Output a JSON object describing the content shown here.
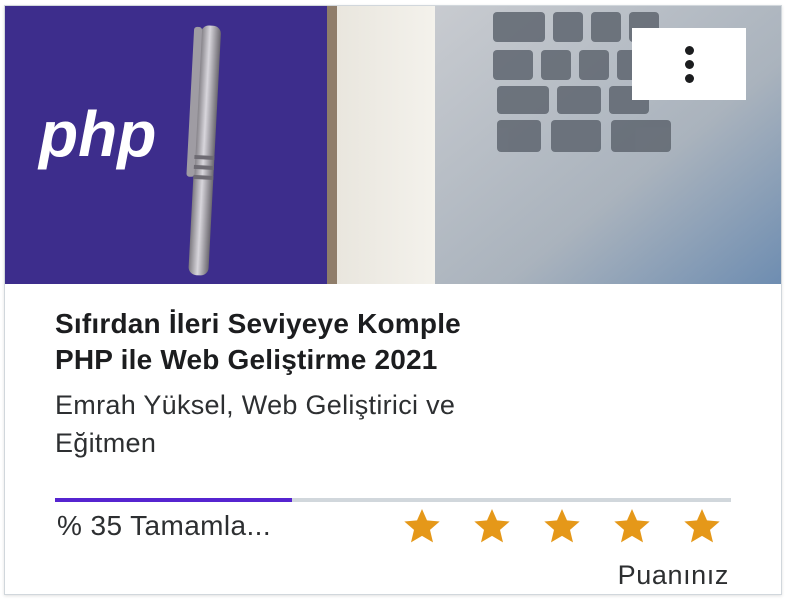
{
  "course": {
    "title_line1": "Sıfırdan İleri Seviyeye Komple",
    "title_line2": "PHP ile Web Geliştirme 2021",
    "instructor_line1": "Emrah Yüksel, Web Geliştirici ve",
    "instructor_line2": "Eğitmen",
    "thumbnail_text": "php",
    "progress_percent": 35,
    "progress_label": "% 35 Tamamla...",
    "rating_stars_filled": 5,
    "rating_stars_total": 5,
    "rate_label": "Puanınız"
  },
  "icons": {
    "menu": "more-vertical-icon",
    "star": "star-icon"
  },
  "colors": {
    "progress": "#5624d0",
    "star": "#e59819",
    "thumbnail_purple": "#3d2d8c"
  }
}
